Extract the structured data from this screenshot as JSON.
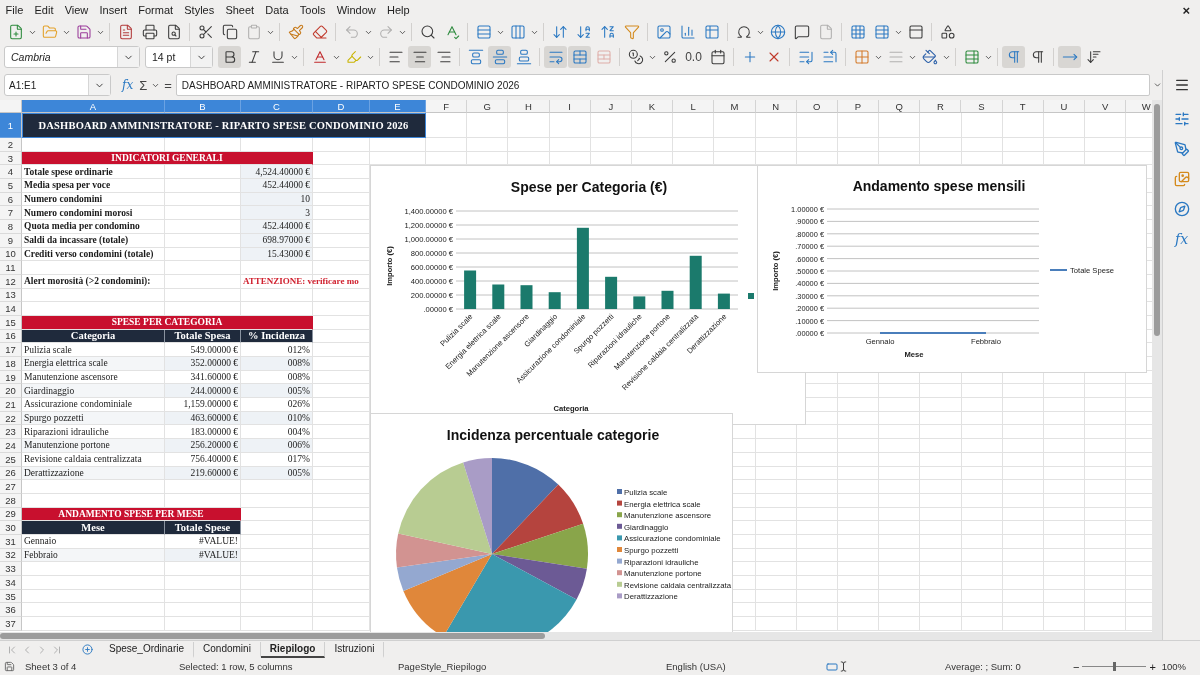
{
  "menu": [
    "File",
    "Edit",
    "View",
    "Insert",
    "Format",
    "Styles",
    "Sheet",
    "Data",
    "Tools",
    "Window",
    "Help"
  ],
  "document_close": "×",
  "standard_toolbar": {
    "disabled": {
      "paste": true,
      "undo": true,
      "redo": true,
      "header_footer": true
    }
  },
  "format_toolbar": {
    "font_name": "Cambria",
    "font_size": "14 pt",
    "number_format": "0.0",
    "toggles": {
      "bold": true,
      "italic": false,
      "underline": false,
      "align_left": false,
      "align_center": true,
      "align_right": false,
      "align_top": false,
      "align_middle": true,
      "align_bottom": false,
      "wrap_text": true,
      "merge_center": true,
      "left_to_right": true,
      "right_to_left": false,
      "text_direction": true
    },
    "disabled": {
      "unmerge": true,
      "border_style": true
    }
  },
  "formula_bar": {
    "cell_reference": "A1:E1",
    "function_wizard": "fx",
    "sum": "Σ",
    "equals": "=",
    "content": "DASHBOARD AMMINISTRATORE - RIPARTO SPESE CONDOMINIO 2026"
  },
  "sidebar": {
    "functions": "fx"
  },
  "sheet": {
    "columns": [
      {
        "label": "A",
        "selected": true
      },
      {
        "label": "B",
        "selected": true
      },
      {
        "label": "C",
        "selected": true
      },
      {
        "label": "D",
        "selected": true
      },
      {
        "label": "E",
        "selected": true
      },
      {
        "label": "F",
        "selected": false
      },
      {
        "label": "G",
        "selected": false
      },
      {
        "label": "H",
        "selected": false
      },
      {
        "label": "I",
        "selected": false
      },
      {
        "label": "J",
        "selected": false
      },
      {
        "label": "K",
        "selected": false
      },
      {
        "label": "L",
        "selected": false
      },
      {
        "label": "M",
        "selected": false
      },
      {
        "label": "N",
        "selected": false
      },
      {
        "label": "O",
        "selected": false
      },
      {
        "label": "P",
        "selected": false
      },
      {
        "label": "Q",
        "selected": false
      },
      {
        "label": "R",
        "selected": false
      },
      {
        "label": "S",
        "selected": false
      },
      {
        "label": "T",
        "selected": false
      },
      {
        "label": "U",
        "selected": false
      },
      {
        "label": "V",
        "selected": false
      },
      {
        "label": "W",
        "selected": false
      }
    ],
    "rows": [
      {
        "number": "1",
        "selected": true,
        "kind": "title",
        "cells": [
          "DASHBOARD AMMINISTRATORE - RIPARTO SPESE CONDOMINIO 2026"
        ]
      },
      {
        "number": "2",
        "selected": false,
        "kind": "blank"
      },
      {
        "number": "3",
        "selected": false,
        "kind": "band3",
        "cells": [
          "INDICATORI GENERALI"
        ]
      },
      {
        "number": "4",
        "selected": false,
        "kind": "metric",
        "cells": [
          "Totale spese ordinarie",
          "4,524.40000 €"
        ]
      },
      {
        "number": "5",
        "selected": false,
        "kind": "metric",
        "cells": [
          "Media spesa per voce",
          "452.44000 €"
        ]
      },
      {
        "number": "6",
        "selected": false,
        "kind": "metric",
        "cells": [
          "Numero condomini",
          "10"
        ]
      },
      {
        "number": "7",
        "selected": false,
        "kind": "metric",
        "cells": [
          "Numero condomini morosi",
          "3"
        ]
      },
      {
        "number": "8",
        "selected": false,
        "kind": "metric",
        "cells": [
          "Quota media per condomino",
          "452.44000 €"
        ]
      },
      {
        "number": "9",
        "selected": false,
        "kind": "metric",
        "cells": [
          "Saldi da incassare (totale)",
          "698.97000 €"
        ]
      },
      {
        "number": "10",
        "selected": false,
        "kind": "metric",
        "cells": [
          "Crediti verso condomini (totale)",
          "15.43000 €"
        ]
      },
      {
        "number": "11",
        "selected": false,
        "kind": "blank"
      },
      {
        "number": "12",
        "selected": false,
        "kind": "alert",
        "cells": [
          "Alert morosità (>2 condomini):",
          "ATTENZIONE: verificare mo"
        ]
      },
      {
        "number": "13",
        "selected": false,
        "kind": "blank"
      },
      {
        "number": "14",
        "selected": false,
        "kind": "blank"
      },
      {
        "number": "15",
        "selected": false,
        "kind": "band3",
        "cells": [
          "SPESE PER CATEGORIA"
        ]
      },
      {
        "number": "16",
        "selected": false,
        "kind": "header3",
        "cells": [
          "Categoria",
          "Totale Spesa",
          "% Incidenza"
        ]
      },
      {
        "number": "17",
        "selected": false,
        "kind": "category",
        "cells": [
          "Pulizia scale",
          "549.00000 €",
          "012%"
        ]
      },
      {
        "number": "18",
        "selected": false,
        "kind": "category",
        "cells": [
          "Energia elettrica scale",
          "352.00000 €",
          "008%"
        ]
      },
      {
        "number": "19",
        "selected": false,
        "kind": "category",
        "cells": [
          "Manutenzione ascensore",
          "341.60000 €",
          "008%"
        ]
      },
      {
        "number": "20",
        "selected": false,
        "kind": "category",
        "cells": [
          "Giardinaggio",
          "244.00000 €",
          "005%"
        ]
      },
      {
        "number": "21",
        "selected": false,
        "kind": "category",
        "cells": [
          "Assicurazione condominiale",
          "1,159.00000 €",
          "026%"
        ]
      },
      {
        "number": "22",
        "selected": false,
        "kind": "category",
        "cells": [
          "Spurgo pozzetti",
          "463.60000 €",
          "010%"
        ]
      },
      {
        "number": "23",
        "selected": false,
        "kind": "category",
        "cells": [
          "Riparazioni idrauliche",
          "183.00000 €",
          "004%"
        ]
      },
      {
        "number": "24",
        "selected": false,
        "kind": "category",
        "cells": [
          "Manutenzione portone",
          "256.20000 €",
          "006%"
        ]
      },
      {
        "number": "25",
        "selected": false,
        "kind": "category",
        "cells": [
          "Revisione caldaia centralizzata",
          "756.40000 €",
          "017%"
        ]
      },
      {
        "number": "26",
        "selected": false,
        "kind": "category",
        "cells": [
          "Derattizzazione",
          "219.60000 €",
          "005%"
        ]
      },
      {
        "number": "27",
        "selected": false,
        "kind": "blank"
      },
      {
        "number": "28",
        "selected": false,
        "kind": "blank"
      },
      {
        "number": "29",
        "selected": false,
        "kind": "band2",
        "cells": [
          "ANDAMENTO SPESE PER MESE"
        ]
      },
      {
        "number": "30",
        "selected": false,
        "kind": "header2",
        "cells": [
          "Mese",
          "Totale Spese"
        ]
      },
      {
        "number": "31",
        "selected": false,
        "kind": "month",
        "cells": [
          "Gennaio",
          "#VALUE!"
        ]
      },
      {
        "number": "32",
        "selected": false,
        "kind": "month",
        "cells": [
          "Febbraio",
          "#VALUE!"
        ]
      },
      {
        "number": "33",
        "selected": false,
        "kind": "blank"
      },
      {
        "number": "34",
        "selected": false,
        "kind": "blank"
      },
      {
        "number": "35",
        "selected": false,
        "kind": "blank"
      },
      {
        "number": "36",
        "selected": false,
        "kind": "blank"
      },
      {
        "number": "37",
        "selected": false,
        "kind": "blank"
      }
    ]
  },
  "charts": [
    {
      "chart_data": {
        "type": "bar",
        "title": "Spese per Categoria (€)",
        "xlabel": "Categoria",
        "ylabel": "Importo (€)",
        "categories": [
          "Pulizia scale",
          "Energia elettrica scale",
          "Manutenzione ascensore",
          "Giardinaggio",
          "Assicurazione condominiale",
          "Spurgo pozzetti",
          "Riparazioni idrauliche",
          "Manutenzione portone",
          "Revisione caldaia centralizzata",
          "Derattizzazione"
        ],
        "series": [
          {
            "color": "#1b7a6c",
            "values": [
              550,
              350,
              340,
              240,
              1160,
              460,
              180,
              260,
              760,
              220
            ]
          }
        ],
        "grid": true,
        "ylim": [
          0,
          1400
        ],
        "yticks": [
          {
            "value": 0,
            "label": ".00000 €"
          },
          {
            "value": 200,
            "label": "200.00000 €"
          },
          {
            "value": 400,
            "label": "400.00000 €"
          },
          {
            "value": 600,
            "label": "600.00000 €"
          },
          {
            "value": 800,
            "label": "800.00000 €"
          },
          {
            "value": 1000,
            "label": "1,000.00000 €"
          },
          {
            "value": 1200,
            "label": "1,200.00000 €"
          },
          {
            "value": 1400,
            "label": "1,400.00000 €"
          }
        ]
      }
    },
    {
      "chart_data": {
        "type": "line",
        "title": "Andamento spese mensili",
        "xlabel": "Mese",
        "ylabel": "Importo (€)",
        "categories": [
          "Gennaio",
          "Febbraio"
        ],
        "series": [
          {
            "name": "Totale Spese",
            "color": "#4a7ebb",
            "values": [
              0,
              0
            ]
          }
        ],
        "grid": true,
        "legend": true,
        "ylim": [
          0,
          1
        ],
        "yticks": [
          {
            "value": 0,
            "label": ".00000 €"
          },
          {
            "value": 0.1,
            "label": ".10000 €"
          },
          {
            "value": 0.2,
            "label": ".20000 €"
          },
          {
            "value": 0.3,
            "label": ".30000 €"
          },
          {
            "value": 0.4,
            "label": ".40000 €"
          },
          {
            "value": 0.5,
            "label": ".50000 €"
          },
          {
            "value": 0.6,
            "label": ".60000 €"
          },
          {
            "value": 0.7,
            "label": ".70000 €"
          },
          {
            "value": 0.8,
            "label": ".80000 €"
          },
          {
            "value": 0.9,
            "label": ".90000 €"
          },
          {
            "value": 1,
            "label": "1.00000 €"
          }
        ]
      }
    },
    {
      "chart_data": {
        "type": "pie",
        "title": "Incidenza percentuale categorie",
        "categories": [
          "Pulizia scale",
          "Energia elettrica scale",
          "Manutenzione ascensore",
          "Giardinaggio",
          "Assicurazione condominiale",
          "Spurgo pozzetti",
          "Riparazioni idrauliche",
          "Manutenzione portone",
          "Revisione caldaia centralizzata",
          "Derattizzazione"
        ],
        "series": [
          {
            "values": [
              12.13,
              7.78,
              7.55,
              5.39,
              25.62,
              10.25,
              4.04,
              5.66,
              16.72,
              4.86
            ]
          }
        ],
        "legend": true,
        "colors": [
          "#4f6fa8",
          "#b5443e",
          "#89a54a",
          "#6c5a95",
          "#3a98ae",
          "#e0873a",
          "#94a8d0",
          "#d29391",
          "#b8cc92",
          "#a99cc6"
        ]
      }
    }
  ],
  "sheet_tabs": [
    {
      "label": "Spese_Ordinarie",
      "selected": false
    },
    {
      "label": "Condomini",
      "selected": false
    },
    {
      "label": "Riepilogo",
      "selected": true
    },
    {
      "label": "Istruzioni",
      "selected": false
    }
  ],
  "status_bar": {
    "sheet": "Sheet 3 of 4",
    "selection": "Selected: 1 row, 5 columns",
    "page_style": "PageStyle_Riepilogo",
    "language": "English (USA)",
    "summary": "Average: ; Sum: 0",
    "zoom_out": "−",
    "zoom": {
      "level": 0.48
    },
    "zoom_in": "+",
    "zoom_percent": "100%"
  }
}
